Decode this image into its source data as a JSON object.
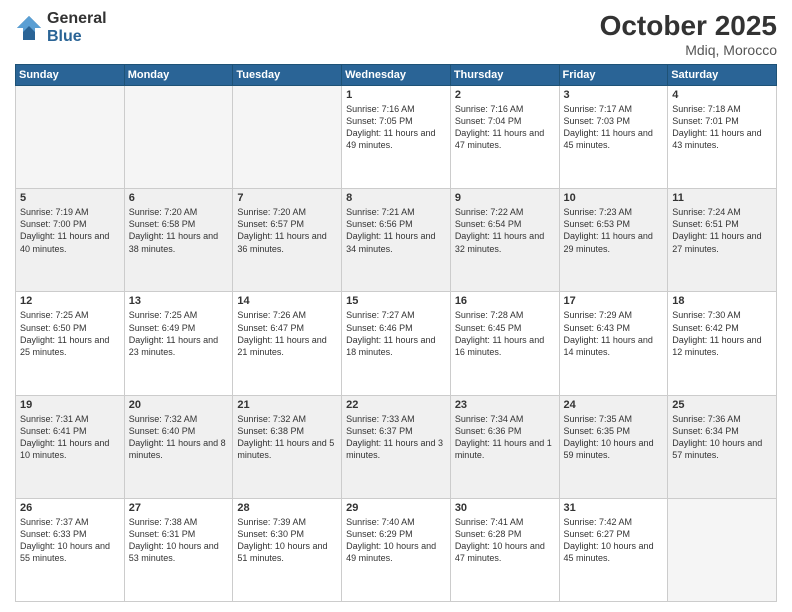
{
  "logo": {
    "general": "General",
    "blue": "Blue"
  },
  "title": "October 2025",
  "location": "Mdiq, Morocco",
  "days_header": [
    "Sunday",
    "Monday",
    "Tuesday",
    "Wednesday",
    "Thursday",
    "Friday",
    "Saturday"
  ],
  "weeks": [
    [
      {
        "day": "",
        "empty": true
      },
      {
        "day": "",
        "empty": true
      },
      {
        "day": "",
        "empty": true
      },
      {
        "day": "1",
        "sunrise": "Sunrise: 7:16 AM",
        "sunset": "Sunset: 7:05 PM",
        "daylight": "Daylight: 11 hours and 49 minutes."
      },
      {
        "day": "2",
        "sunrise": "Sunrise: 7:16 AM",
        "sunset": "Sunset: 7:04 PM",
        "daylight": "Daylight: 11 hours and 47 minutes."
      },
      {
        "day": "3",
        "sunrise": "Sunrise: 7:17 AM",
        "sunset": "Sunset: 7:03 PM",
        "daylight": "Daylight: 11 hours and 45 minutes."
      },
      {
        "day": "4",
        "sunrise": "Sunrise: 7:18 AM",
        "sunset": "Sunset: 7:01 PM",
        "daylight": "Daylight: 11 hours and 43 minutes."
      }
    ],
    [
      {
        "day": "5",
        "sunrise": "Sunrise: 7:19 AM",
        "sunset": "Sunset: 7:00 PM",
        "daylight": "Daylight: 11 hours and 40 minutes."
      },
      {
        "day": "6",
        "sunrise": "Sunrise: 7:20 AM",
        "sunset": "Sunset: 6:58 PM",
        "daylight": "Daylight: 11 hours and 38 minutes."
      },
      {
        "day": "7",
        "sunrise": "Sunrise: 7:20 AM",
        "sunset": "Sunset: 6:57 PM",
        "daylight": "Daylight: 11 hours and 36 minutes."
      },
      {
        "day": "8",
        "sunrise": "Sunrise: 7:21 AM",
        "sunset": "Sunset: 6:56 PM",
        "daylight": "Daylight: 11 hours and 34 minutes."
      },
      {
        "day": "9",
        "sunrise": "Sunrise: 7:22 AM",
        "sunset": "Sunset: 6:54 PM",
        "daylight": "Daylight: 11 hours and 32 minutes."
      },
      {
        "day": "10",
        "sunrise": "Sunrise: 7:23 AM",
        "sunset": "Sunset: 6:53 PM",
        "daylight": "Daylight: 11 hours and 29 minutes."
      },
      {
        "day": "11",
        "sunrise": "Sunrise: 7:24 AM",
        "sunset": "Sunset: 6:51 PM",
        "daylight": "Daylight: 11 hours and 27 minutes."
      }
    ],
    [
      {
        "day": "12",
        "sunrise": "Sunrise: 7:25 AM",
        "sunset": "Sunset: 6:50 PM",
        "daylight": "Daylight: 11 hours and 25 minutes."
      },
      {
        "day": "13",
        "sunrise": "Sunrise: 7:25 AM",
        "sunset": "Sunset: 6:49 PM",
        "daylight": "Daylight: 11 hours and 23 minutes."
      },
      {
        "day": "14",
        "sunrise": "Sunrise: 7:26 AM",
        "sunset": "Sunset: 6:47 PM",
        "daylight": "Daylight: 11 hours and 21 minutes."
      },
      {
        "day": "15",
        "sunrise": "Sunrise: 7:27 AM",
        "sunset": "Sunset: 6:46 PM",
        "daylight": "Daylight: 11 hours and 18 minutes."
      },
      {
        "day": "16",
        "sunrise": "Sunrise: 7:28 AM",
        "sunset": "Sunset: 6:45 PM",
        "daylight": "Daylight: 11 hours and 16 minutes."
      },
      {
        "day": "17",
        "sunrise": "Sunrise: 7:29 AM",
        "sunset": "Sunset: 6:43 PM",
        "daylight": "Daylight: 11 hours and 14 minutes."
      },
      {
        "day": "18",
        "sunrise": "Sunrise: 7:30 AM",
        "sunset": "Sunset: 6:42 PM",
        "daylight": "Daylight: 11 hours and 12 minutes."
      }
    ],
    [
      {
        "day": "19",
        "sunrise": "Sunrise: 7:31 AM",
        "sunset": "Sunset: 6:41 PM",
        "daylight": "Daylight: 11 hours and 10 minutes."
      },
      {
        "day": "20",
        "sunrise": "Sunrise: 7:32 AM",
        "sunset": "Sunset: 6:40 PM",
        "daylight": "Daylight: 11 hours and 8 minutes."
      },
      {
        "day": "21",
        "sunrise": "Sunrise: 7:32 AM",
        "sunset": "Sunset: 6:38 PM",
        "daylight": "Daylight: 11 hours and 5 minutes."
      },
      {
        "day": "22",
        "sunrise": "Sunrise: 7:33 AM",
        "sunset": "Sunset: 6:37 PM",
        "daylight": "Daylight: 11 hours and 3 minutes."
      },
      {
        "day": "23",
        "sunrise": "Sunrise: 7:34 AM",
        "sunset": "Sunset: 6:36 PM",
        "daylight": "Daylight: 11 hours and 1 minute."
      },
      {
        "day": "24",
        "sunrise": "Sunrise: 7:35 AM",
        "sunset": "Sunset: 6:35 PM",
        "daylight": "Daylight: 10 hours and 59 minutes."
      },
      {
        "day": "25",
        "sunrise": "Sunrise: 7:36 AM",
        "sunset": "Sunset: 6:34 PM",
        "daylight": "Daylight: 10 hours and 57 minutes."
      }
    ],
    [
      {
        "day": "26",
        "sunrise": "Sunrise: 7:37 AM",
        "sunset": "Sunset: 6:33 PM",
        "daylight": "Daylight: 10 hours and 55 minutes."
      },
      {
        "day": "27",
        "sunrise": "Sunrise: 7:38 AM",
        "sunset": "Sunset: 6:31 PM",
        "daylight": "Daylight: 10 hours and 53 minutes."
      },
      {
        "day": "28",
        "sunrise": "Sunrise: 7:39 AM",
        "sunset": "Sunset: 6:30 PM",
        "daylight": "Daylight: 10 hours and 51 minutes."
      },
      {
        "day": "29",
        "sunrise": "Sunrise: 7:40 AM",
        "sunset": "Sunset: 6:29 PM",
        "daylight": "Daylight: 10 hours and 49 minutes."
      },
      {
        "day": "30",
        "sunrise": "Sunrise: 7:41 AM",
        "sunset": "Sunset: 6:28 PM",
        "daylight": "Daylight: 10 hours and 47 minutes."
      },
      {
        "day": "31",
        "sunrise": "Sunrise: 7:42 AM",
        "sunset": "Sunset: 6:27 PM",
        "daylight": "Daylight: 10 hours and 45 minutes."
      },
      {
        "day": "",
        "empty": true
      }
    ]
  ]
}
